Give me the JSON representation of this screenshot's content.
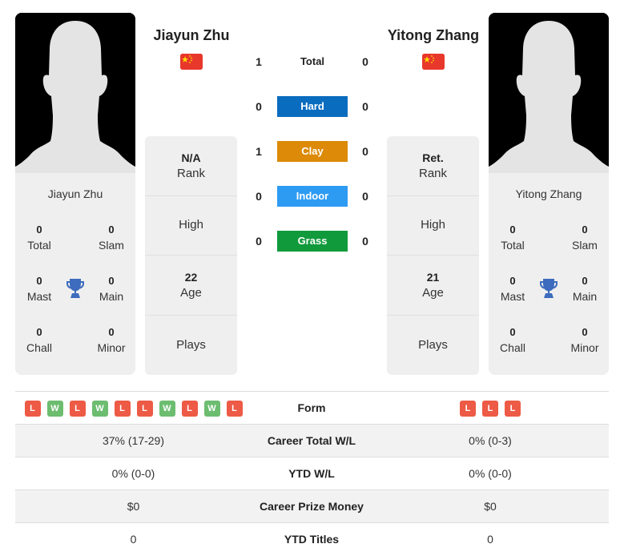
{
  "colors": {
    "hard": "#0a6cbf",
    "clay": "#dc8a07",
    "indoor": "#2e9bf3",
    "grass": "#119a3c",
    "win": "#6cbd70",
    "loss": "#ed5a45",
    "trophy": "#3d6bbd",
    "flag_red": "#e8372b",
    "flag_star": "#ffde00"
  },
  "player1": {
    "name": "Jiayun Zhu",
    "country": "China",
    "flag_icon": "china-flag-icon",
    "card_name": "Jiayun Zhu",
    "titles": {
      "total": {
        "value": "0",
        "label": "Total"
      },
      "slam": {
        "value": "0",
        "label": "Slam"
      },
      "mast": {
        "value": "0",
        "label": "Mast"
      },
      "main": {
        "value": "0",
        "label": "Main"
      },
      "chall": {
        "value": "0",
        "label": "Chall"
      },
      "minor": {
        "value": "0",
        "label": "Minor"
      }
    },
    "info": {
      "rank": {
        "value": "N/A",
        "label": "Rank"
      },
      "high": {
        "value": "",
        "label": "High"
      },
      "age": {
        "value": "22",
        "label": "Age"
      },
      "plays": {
        "value": "",
        "label": "Plays"
      }
    },
    "form": [
      "L",
      "W",
      "L",
      "W",
      "L",
      "L",
      "W",
      "L",
      "W",
      "L"
    ]
  },
  "player2": {
    "name": "Yitong Zhang",
    "country": "China",
    "flag_icon": "china-flag-icon",
    "card_name": "Yitong Zhang",
    "titles": {
      "total": {
        "value": "0",
        "label": "Total"
      },
      "slam": {
        "value": "0",
        "label": "Slam"
      },
      "mast": {
        "value": "0",
        "label": "Mast"
      },
      "main": {
        "value": "0",
        "label": "Main"
      },
      "chall": {
        "value": "0",
        "label": "Chall"
      },
      "minor": {
        "value": "0",
        "label": "Minor"
      }
    },
    "info": {
      "rank": {
        "value": "Ret.",
        "label": "Rank"
      },
      "high": {
        "value": "",
        "label": "High"
      },
      "age": {
        "value": "21",
        "label": "Age"
      },
      "plays": {
        "value": "",
        "label": "Plays"
      }
    },
    "form": [
      "L",
      "L",
      "L"
    ]
  },
  "h2h": [
    {
      "label": "Total",
      "key": "total",
      "p1": "1",
      "p2": "0"
    },
    {
      "label": "Hard",
      "key": "hard",
      "p1": "0",
      "p2": "0"
    },
    {
      "label": "Clay",
      "key": "clay",
      "p1": "1",
      "p2": "0"
    },
    {
      "label": "Indoor",
      "key": "indoor",
      "p1": "0",
      "p2": "0"
    },
    {
      "label": "Grass",
      "key": "grass",
      "p1": "0",
      "p2": "0"
    }
  ],
  "stats": [
    {
      "label": "Form",
      "p1": "",
      "p2": ""
    },
    {
      "label": "Career Total W/L",
      "p1": "37% (17-29)",
      "p2": "0% (0-3)"
    },
    {
      "label": "YTD W/L",
      "p1": "0% (0-0)",
      "p2": "0% (0-0)"
    },
    {
      "label": "Career Prize Money",
      "p1": "$0",
      "p2": "$0"
    },
    {
      "label": "YTD Titles",
      "p1": "0",
      "p2": "0"
    }
  ]
}
